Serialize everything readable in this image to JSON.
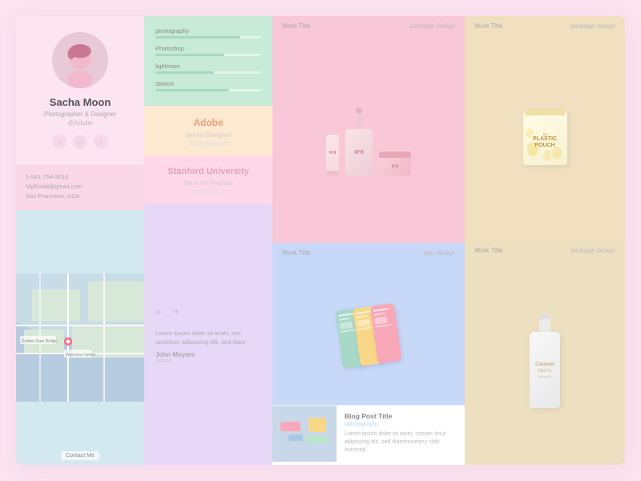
{
  "profile": {
    "name": "Sacha Moon",
    "title": "Photographer & Designer",
    "handle": "@Adobe",
    "avatar_alt": "profile avatar"
  },
  "contact": {
    "phone": "1-541-754-3010",
    "email": "MyEmail@gmail.com",
    "location": "San Francisco, USA",
    "map_label": "Contact Me"
  },
  "skills": {
    "items": [
      {
        "label": "Photography",
        "percent": 80
      },
      {
        "label": "Photoshop",
        "percent": 65
      },
      {
        "label": "Lightroom",
        "percent": 55
      },
      {
        "label": "Sketch",
        "percent": 70
      }
    ]
  },
  "experience": {
    "company": "Adobe",
    "role": "Senior Designer",
    "period": "2013–present"
  },
  "education": {
    "school": "Stanford University",
    "degree": "BA in Art Practice",
    "period": "2010–2013"
  },
  "testimonial": {
    "text": "Lorem ipsum dolor sit amet, con sectetuer adipiscing elit, sed diam",
    "author": "John Moyers",
    "company": "Adobe"
  },
  "work_items": [
    {
      "id": "w1",
      "title": "Work Title",
      "category": "package design",
      "column": 3,
      "row": 1
    },
    {
      "id": "w2",
      "title": "Work Title",
      "category": "app design",
      "column": 3,
      "row": 2
    },
    {
      "id": "w3",
      "title": "Work Title",
      "category": "package design",
      "column": 4,
      "row": 1
    },
    {
      "id": "w4",
      "title": "Work Title",
      "category": "package design",
      "column": 4,
      "row": 2
    }
  ],
  "blog": {
    "title": "Blog Post Title",
    "tag": "#photography",
    "text": "Lorem ipsum dolor sit amet, consec tetur adipiscing elit, sed dianonnummy nibh euismod"
  },
  "social": {
    "twitter": "t",
    "instagram": "i",
    "facebook": "f"
  },
  "labels": {
    "contact_me": "Contact Me",
    "work_title": "Work Title",
    "package_design": "package design",
    "app_design": "app design",
    "blog_title": "Blog Post Title",
    "photography_tag": "#photography"
  },
  "pouch": {
    "brand": "TM",
    "name": "PLASTIC\nPOUCH",
    "sub": "package design"
  },
  "bottle": {
    "name": "Carazon\nDESTIL",
    "sub": "premium"
  },
  "cosmetics": {
    "line1": "Nº8",
    "line2": "Nº8"
  }
}
